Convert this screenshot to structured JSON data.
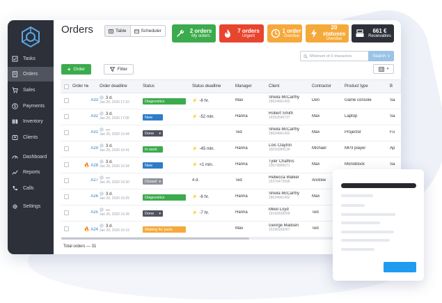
{
  "page_title": "Orders",
  "view_toggle": {
    "table": "Table",
    "scheduler": "Scheduler"
  },
  "stats": [
    {
      "big": "2 orders",
      "small": "My orders",
      "color": "#3cab4d",
      "icon": "wrench-icon"
    },
    {
      "big": "7 orders",
      "small": "Urgent",
      "color": "#e8452e",
      "icon": "fire-icon"
    },
    {
      "big": "1 order",
      "small": "Overdue",
      "color": "#f5a93a",
      "icon": "clock-icon"
    },
    {
      "big": "20 statuses",
      "small": "Overdue",
      "color": "#f5a93a",
      "icon": "bolt-icon"
    },
    {
      "big": "661 €",
      "small": "Receivables",
      "color": "#2d3039",
      "icon": "register-icon"
    }
  ],
  "sidebar": {
    "items": [
      {
        "label": "Tasks",
        "icon": "tasks-icon"
      },
      {
        "label": "Orders",
        "icon": "orders-icon"
      },
      {
        "label": "Sales",
        "icon": "cart-icon"
      },
      {
        "label": "Payments",
        "icon": "dollar-icon"
      },
      {
        "label": "Inventory",
        "icon": "inventory-icon"
      },
      {
        "label": "Clients",
        "icon": "clients-icon"
      },
      {
        "label": "Dashboard",
        "icon": "dashboard-icon"
      },
      {
        "label": "Reports",
        "icon": "reports-icon"
      },
      {
        "label": "Calls",
        "icon": "phone-icon"
      },
      {
        "label": "Settings",
        "icon": "gear-icon"
      }
    ],
    "active": "Orders"
  },
  "toolbar": {
    "order_label": "Order",
    "filter_label": "Filter",
    "search_placeholder": "Minimum of 3 characters",
    "search_button": "Search"
  },
  "table": {
    "headers": [
      "Order № ",
      "Order deadline",
      "Status",
      "Status deadline",
      "Manager",
      "Client",
      "Contractor",
      "Product type",
      "B"
    ],
    "rows": [
      {
        "urgent": false,
        "num": "A33",
        "days": "3 d.",
        "date": "Jan 26, 2020 17:10",
        "status": "Diagnostics",
        "status_color": "#3cab4d",
        "sd": "-6 hr.",
        "bolt": true,
        "manager": "Max",
        "client": "Sheila McCarthy",
        "phone": "18024661432",
        "contractor": "Den",
        "product": "Game console",
        "b": "Sa"
      },
      {
        "urgent": false,
        "num": "A32",
        "days": "3 d.",
        "date": "Jan 26, 2020 17:06",
        "status": "New",
        "status_color": "#2f7cc8",
        "sd": "-52 min.",
        "bolt": true,
        "manager": "Hanna",
        "client": "Robert Smith",
        "phone": "14352596737",
        "contractor": "Max",
        "product": "Laptop",
        "b": "Sa"
      },
      {
        "urgent": false,
        "num": "A31",
        "days": "—",
        "date": "Jan 26, 2020 16:44",
        "status": "Done",
        "status_color": "#50545e",
        "sd": "",
        "bolt": false,
        "manager": "Ted",
        "client": "Sheila McCarthy",
        "phone": "18024661432",
        "contractor": "Max",
        "product": "Projector",
        "b": "Fu"
      },
      {
        "urgent": false,
        "num": "A29",
        "days": "3 d.",
        "date": "Jan 26, 2020 16:41",
        "status": "In work",
        "status_color": "#3cab4d",
        "sd": "-45 min.",
        "bolt": true,
        "manager": "Hanna",
        "client": "Lois Clayton",
        "phone": "16016090134",
        "contractor": "Michael",
        "product": "MP3 player",
        "b": "Ap"
      },
      {
        "urgent": true,
        "num": "A28",
        "days": "3 d.",
        "date": "Jan 26, 2020 16:34",
        "status": "New",
        "status_color": "#2f7cc8",
        "sd": "<1 min.",
        "bolt": true,
        "manager": "Hanna",
        "client": "Tyler Chaffins",
        "phone": "13079996671",
        "contractor": "Max",
        "product": "Monoblock",
        "b": "Sa"
      },
      {
        "urgent": false,
        "num": "A27",
        "days": "—",
        "date": "Jan 26, 2020 16:30",
        "status": "Closed",
        "status_color": "#8e939c",
        "sd": "4 d.",
        "bolt": false,
        "manager": "Ted",
        "client": "Rebecca Walker",
        "phone": "15376472596",
        "contractor": "Andrew",
        "product": "",
        "b": ""
      },
      {
        "urgent": false,
        "num": "A26",
        "days": "3 d.",
        "date": "Jan 26, 2020 16:29",
        "status": "Diagnostics",
        "status_color": "#3cab4d",
        "sd": "-6 hr.",
        "bolt": true,
        "manager": "Hanna",
        "client": "Sheila McCarthy",
        "phone": "18024661432",
        "contractor": "Max",
        "product": "",
        "b": ""
      },
      {
        "urgent": false,
        "num": "A25",
        "days": "—",
        "date": "Jan 26, 2020 16:28",
        "status": "Done",
        "status_color": "#50545e",
        "sd": "-7 hr.",
        "bolt": true,
        "manager": "Hanna",
        "client": "Mikel Loyd",
        "phone": "19192828299",
        "contractor": "Ted",
        "product": "",
        "b": ""
      },
      {
        "urgent": true,
        "num": "A24",
        "days": "3 d.",
        "date": "Jan 26, 2020 16:19",
        "status": "Waiting for parts",
        "status_color": "#f5a93a",
        "sd": "",
        "bolt": false,
        "manager": "Max",
        "client": "George Madsen",
        "phone": "15168159267",
        "contractor": "Ted",
        "product": "",
        "b": ""
      }
    ]
  },
  "total": "Total orders — 31"
}
